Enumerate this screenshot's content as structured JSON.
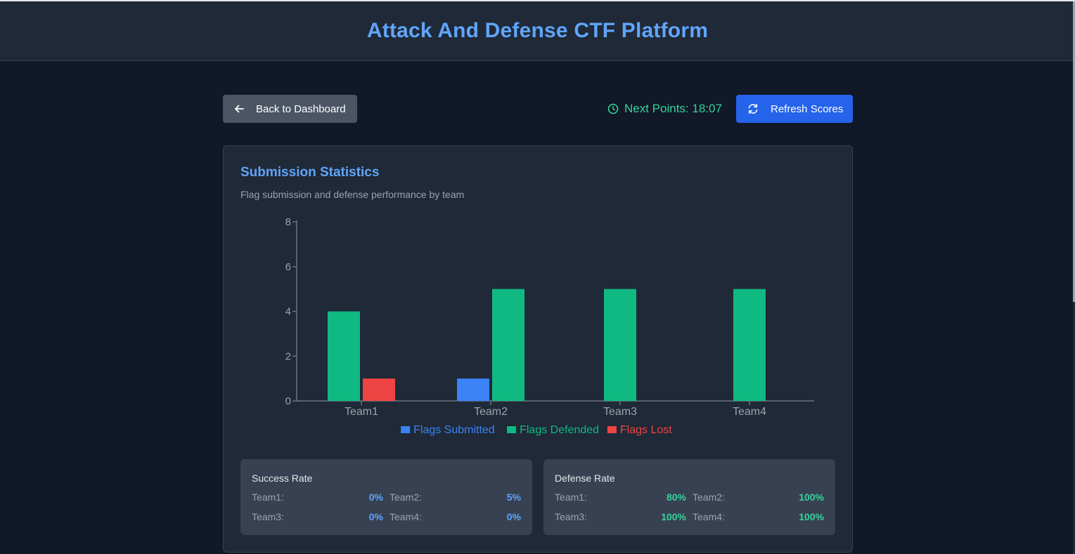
{
  "header": {
    "title": "Attack And Defense CTF Platform"
  },
  "toolbar": {
    "back_label": "Back to Dashboard",
    "next_points": "Next Points: 18:07",
    "refresh_label": "Refresh Scores"
  },
  "card": {
    "title": "Submission Statistics",
    "subtitle": "Flag submission and defense performance by team"
  },
  "colors": {
    "submitted": "#3b82f6",
    "defended": "#10b981",
    "lost": "#ef4444",
    "accent": "#60a5fa"
  },
  "chart_data": {
    "type": "bar",
    "categories": [
      "Team1",
      "Team2",
      "Team3",
      "Team4"
    ],
    "series": [
      {
        "name": "Flags Submitted",
        "values": [
          0,
          1,
          0,
          0
        ]
      },
      {
        "name": "Flags Defended",
        "values": [
          4,
          5,
          5,
          5
        ]
      },
      {
        "name": "Flags Lost",
        "values": [
          1,
          0,
          0,
          0
        ]
      }
    ],
    "yticks": [
      0,
      2,
      4,
      6,
      8
    ],
    "ylim": [
      0,
      8
    ],
    "grid": false,
    "legend": "bottom-center"
  },
  "success_rate": {
    "title": "Success Rate",
    "rows": [
      {
        "label": "Team1:",
        "value": "0%"
      },
      {
        "label": "Team2:",
        "value": "5%"
      },
      {
        "label": "Team3:",
        "value": "0%"
      },
      {
        "label": "Team4:",
        "value": "0%"
      }
    ]
  },
  "defense_rate": {
    "title": "Defense Rate",
    "rows": [
      {
        "label": "Team1:",
        "value": "80%"
      },
      {
        "label": "Team2:",
        "value": "100%"
      },
      {
        "label": "Team3:",
        "value": "100%"
      },
      {
        "label": "Team4:",
        "value": "100%"
      }
    ]
  }
}
